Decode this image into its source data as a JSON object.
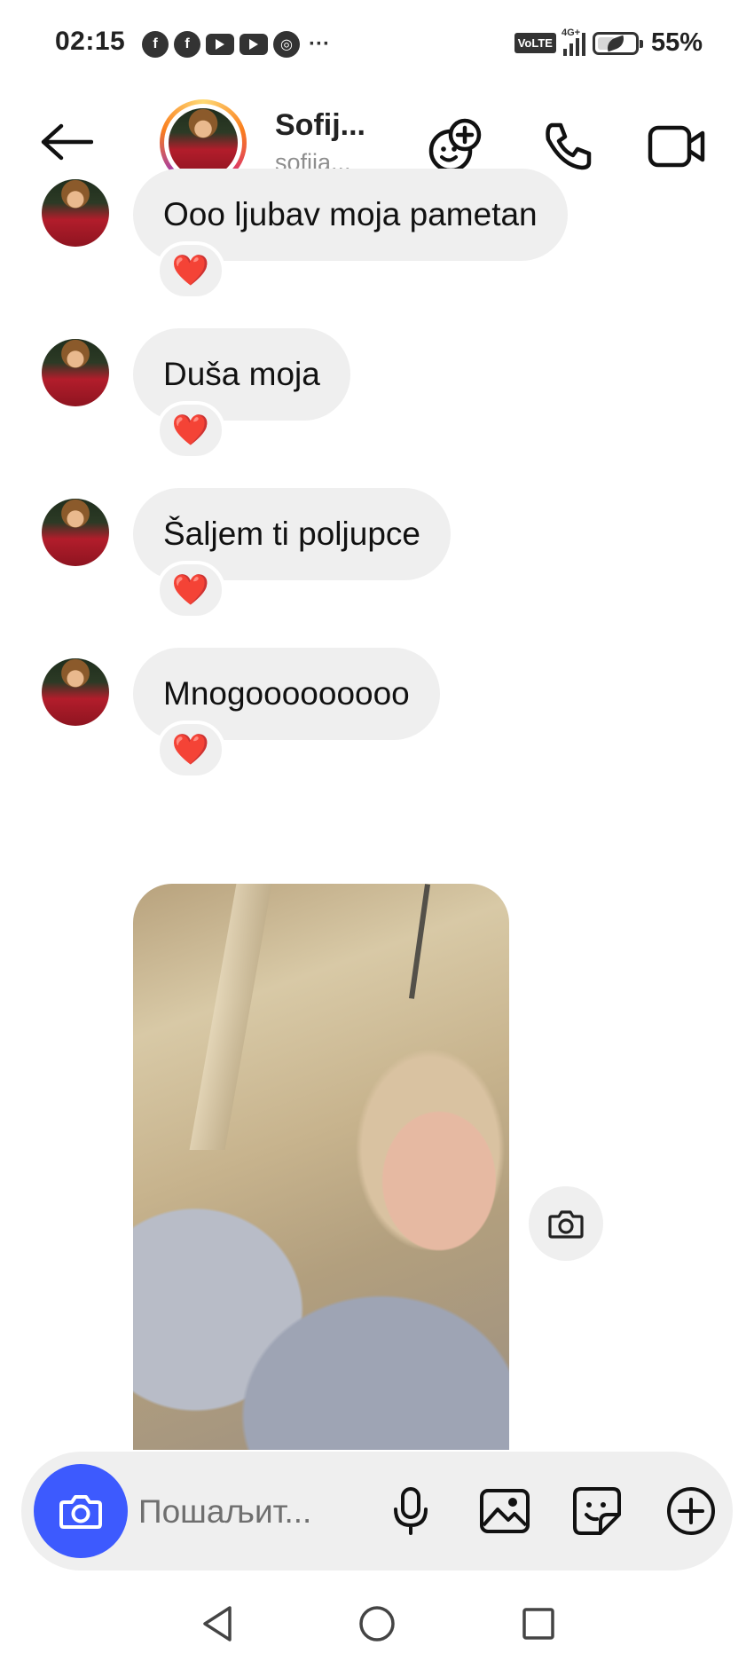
{
  "status_bar": {
    "time": "02:15",
    "apps": [
      "facebook-icon",
      "facebook-icon",
      "youtube-icon",
      "youtube-icon",
      "chrome-icon"
    ],
    "more": "···",
    "volte": "VoLTE",
    "network": "4G+",
    "battery_percent": "55%",
    "battery_level": 0.55
  },
  "header": {
    "name": "Sofij...",
    "username": "sofija..."
  },
  "messages": [
    {
      "text": "Ooo ljubav moja pametan",
      "reaction": "❤️"
    },
    {
      "text": "Duša moja",
      "reaction": "❤️"
    },
    {
      "text": "Šaljem ti poljupce",
      "reaction": "❤️"
    },
    {
      "text": "Mnogooooooooo",
      "reaction": "❤️"
    }
  ],
  "composer": {
    "placeholder": "Пошаљит..."
  },
  "colors": {
    "accent": "#3d5afe",
    "bubble": "#efefef",
    "heart": "#e0202e"
  }
}
